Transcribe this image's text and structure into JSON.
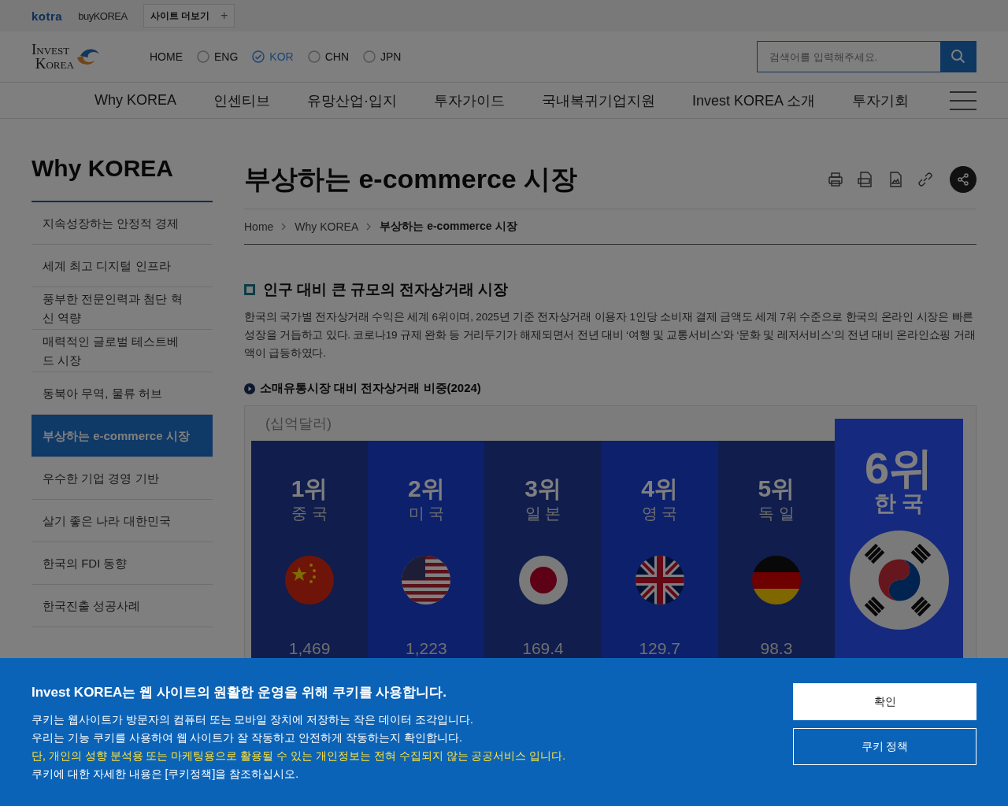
{
  "top_bar": {
    "logos": [
      "kotra",
      "buyKOREA"
    ],
    "more_sites": {
      "label": "사이트 더보기",
      "icon_text": "+"
    }
  },
  "header": {
    "logo_lines": [
      "Invest",
      "Korea"
    ],
    "home": "HOME",
    "languages": [
      {
        "label": "ENG",
        "selected": false
      },
      {
        "label": "KOR",
        "selected": true
      },
      {
        "label": "CHN",
        "selected": false
      },
      {
        "label": "JPN",
        "selected": false
      }
    ],
    "search": {
      "placeholder": "검색어를 입력해주세요."
    }
  },
  "nav": {
    "items": [
      "Why KOREA",
      "인센티브",
      "유망산업·입지",
      "투자가이드",
      "국내복귀기업지원",
      "Invest KOREA 소개",
      "투자기회"
    ]
  },
  "sidebar": {
    "title": "Why KOREA",
    "items": [
      {
        "label": "지속성장하는 안정적 경제",
        "selected": false
      },
      {
        "label": "세계 최고 디지털 인프라",
        "selected": false
      },
      {
        "label": "풍부한 전문인력과 첨단 혁신 역량",
        "selected": false
      },
      {
        "label": "매력적인 글로벌 테스트베드 시장",
        "selected": false
      },
      {
        "label": "동북아 무역, 물류 허브",
        "selected": false
      },
      {
        "label": "부상하는 e-commerce 시장",
        "selected": true
      },
      {
        "label": "우수한 기업 경영 기반",
        "selected": false
      },
      {
        "label": "살기 좋은 나라 대한민국",
        "selected": false
      },
      {
        "label": "한국의 FDI 동향",
        "selected": false
      },
      {
        "label": "한국진출 성공사례",
        "selected": false
      }
    ]
  },
  "article": {
    "title": "부상하는 e-commerce 시장",
    "breadcrumbs": [
      "Home",
      "Why KOREA",
      "부상하는 e-commerce 시장"
    ],
    "section_title": "인구 대비 큰 규모의 전자상거래 시장",
    "paragraph": "한국의 국가별 전자상거래 수익은 세계 6위이며, 2025년 기준 전자상거래 이용자 1인당 소비재 결제 금액도 세계 7위 수준으로 한국의 온라인 시장은 빠른 성장을 거듭하고 있다. 코로나19 규제 완화 등 거리두기가 해제되면서 전년 대비 ‘여행 및 교통서비스’와 ‘문화 및 레저서비스’의 전년 대비 온라인쇼핑 거래액이 급등하였다.",
    "subheading": "소매유통시장 대비 전자상거래 비중(2024)",
    "infographic": {
      "unit": "(십억달러)",
      "columns": [
        {
          "rank": "1위",
          "country": "중 국",
          "value": "1,469",
          "highlighted": false
        },
        {
          "rank": "2위",
          "country": "미 국",
          "value": "1,223",
          "highlighted": false
        },
        {
          "rank": "3위",
          "country": "일 본",
          "value": "169.4",
          "highlighted": false
        },
        {
          "rank": "4위",
          "country": "영 국",
          "value": "129.7",
          "highlighted": false
        },
        {
          "rank": "5위",
          "country": "독 일",
          "value": "98.3",
          "highlighted": false
        },
        {
          "rank": "6위",
          "country": "한 국",
          "highlighted": true
        }
      ]
    }
  },
  "cookie_banner": {
    "title": "Invest KOREA는 웹 사이트의 원활한 운영을 위해 쿠키를 사용합니다.",
    "lines": [
      {
        "text": "쿠키는 웹사이트가 방문자의 컴퓨터 또는 모바일 장치에 저장하는 작은 데이터 조각입니다.",
        "highlighted": false
      },
      {
        "text": "우리는 기능 쿠키를 사용하여 웹 사이트가 잘 작동하고 안전하게 작동하는지 확인합니다.",
        "highlighted": false
      },
      {
        "text": "단, 개인의 성향 분석용 또는 마케팅용으로 활용될 수 있는 개인정보는 전혀 수집되지 않는 공공서비스 입니다.",
        "highlighted": true
      },
      {
        "text": "쿠키에 대한 자세한 내용은 [쿠키정책]을 참조하십시오.",
        "highlighted": false
      }
    ],
    "buttons": [
      {
        "label": "확인",
        "kind": "primary"
      },
      {
        "label": "쿠키 정책",
        "kind": "outline"
      }
    ]
  }
}
